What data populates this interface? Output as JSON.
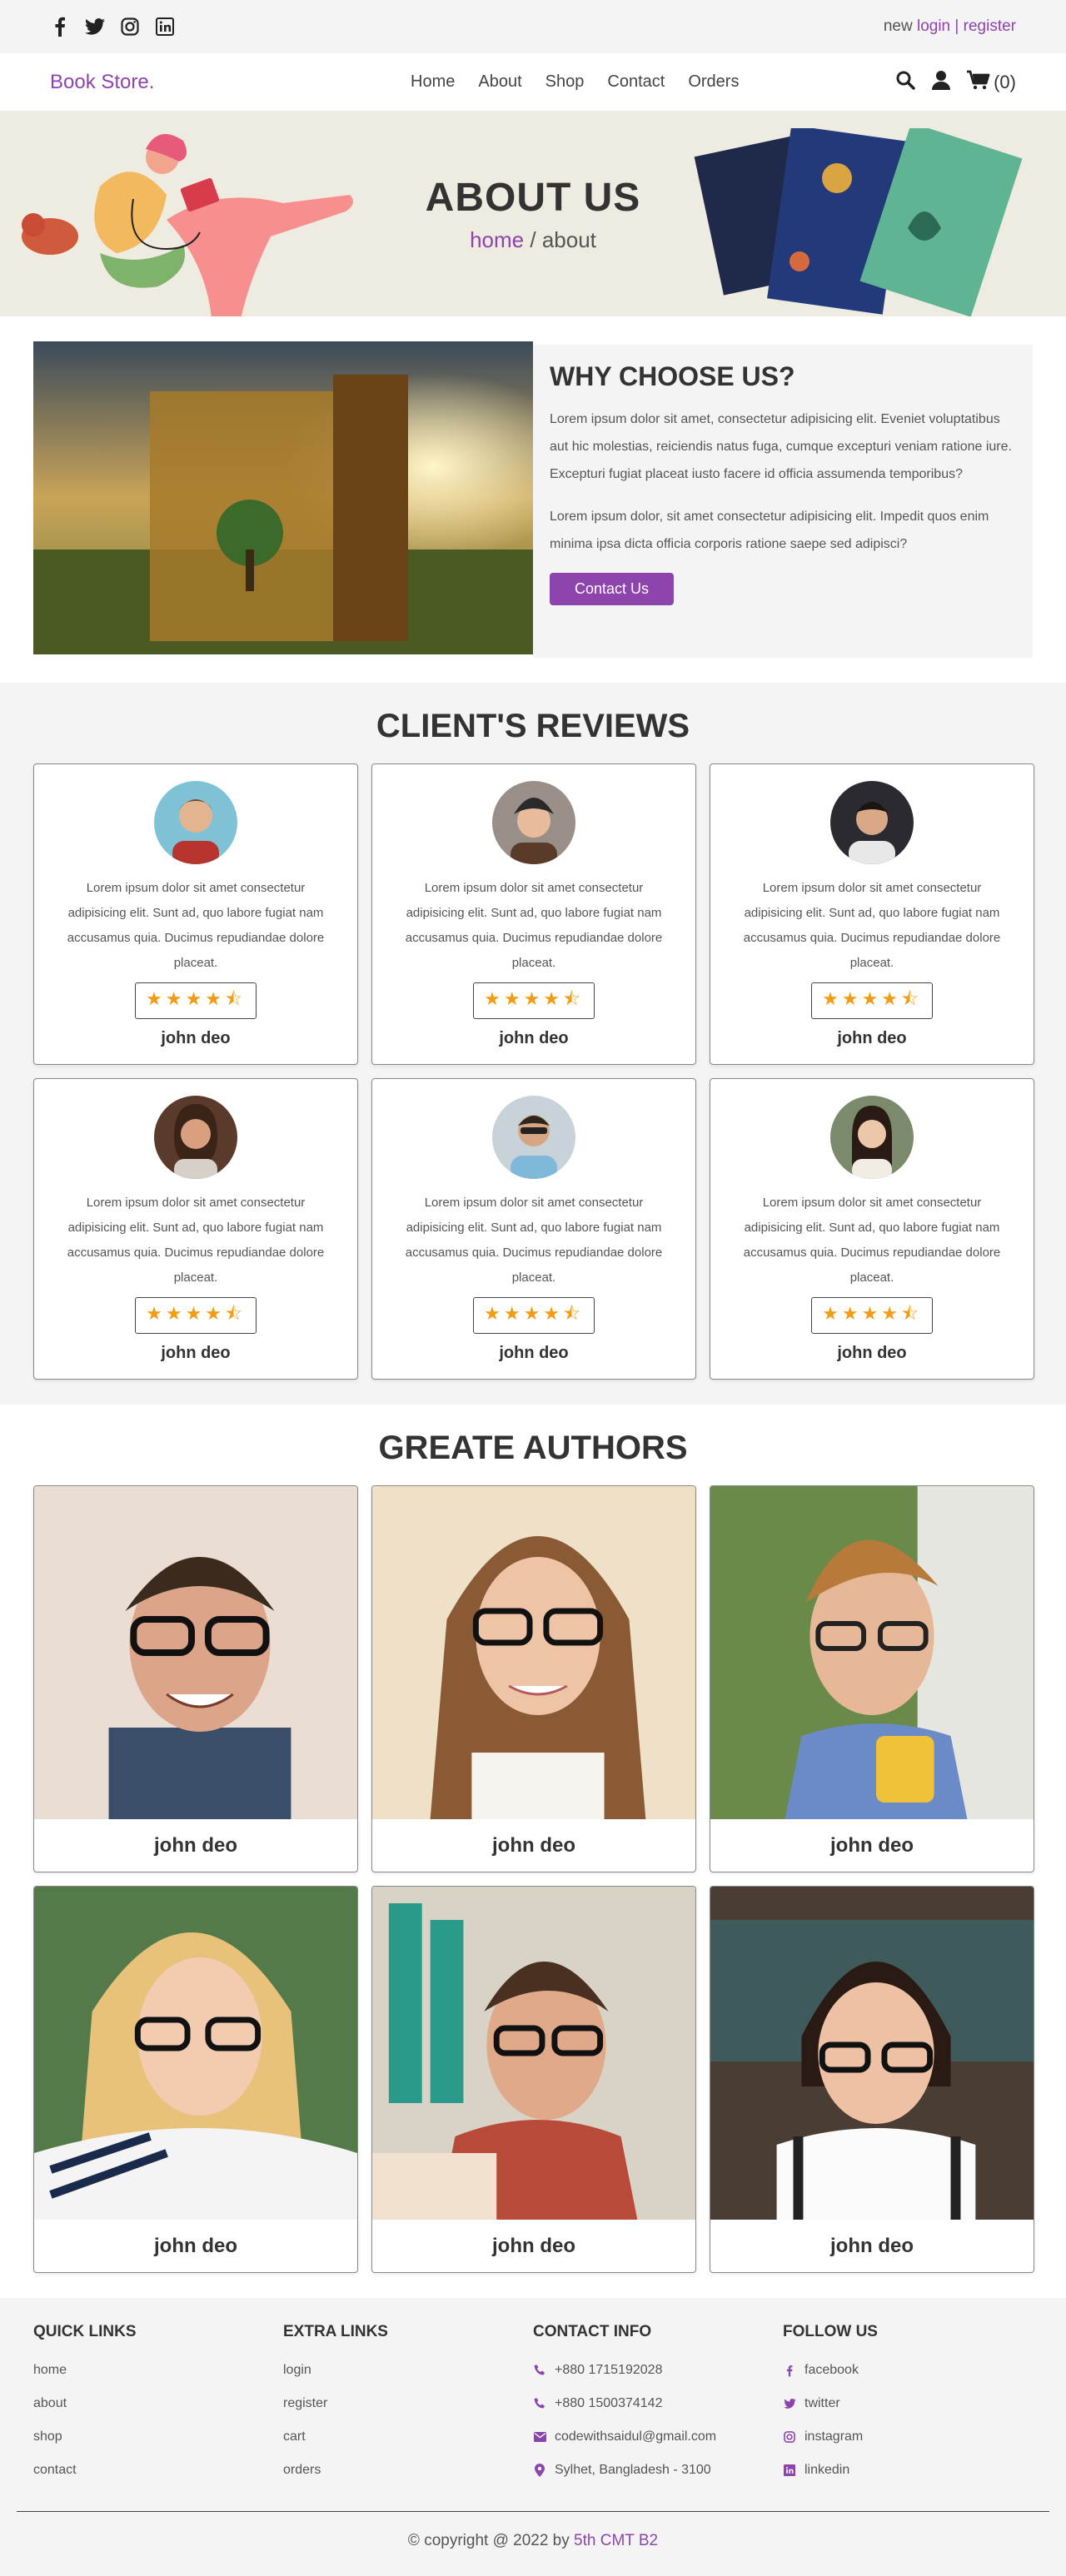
{
  "topbar": {
    "social_icons": [
      "facebook-icon",
      "twitter-icon",
      "instagram-icon",
      "linkedin-icon"
    ],
    "new_label": "new",
    "login_label": "login",
    "separator": "|",
    "register_label": "register"
  },
  "navbar": {
    "logo": "Book Store.",
    "menu": [
      "Home",
      "About",
      "Shop",
      "Contact",
      "Orders"
    ],
    "cart_count": "(0)"
  },
  "hero": {
    "title": "ABOUT US",
    "crumb_home": "home",
    "crumb_sep": "/",
    "crumb_current": "about"
  },
  "why": {
    "title": "WHY CHOOSE US?",
    "paragraph1": "Lorem ipsum dolor sit amet, consectetur adipisicing elit. Eveniet voluptatibus aut hic molestias, reiciendis natus fuga, cumque excepturi veniam ratione iure. Excepturi fugiat placeat iusto facere id officia assumenda temporibus?",
    "paragraph2": "Lorem ipsum dolor, sit amet consectetur adipisicing elit. Impedit quos enim minima ipsa dicta officia corporis ratione saepe sed adipisci?",
    "button": "Contact Us"
  },
  "reviews": {
    "title": "CLIENT'S REVIEWS",
    "items": [
      {
        "text": "Lorem ipsum dolor sit amet consectetur adipisicing elit. Sunt ad, quo labore fugiat nam accusamus quia. Ducimus repudiandae dolore placeat.",
        "name": "john deo",
        "rating": 4.5
      },
      {
        "text": "Lorem ipsum dolor sit amet consectetur adipisicing elit. Sunt ad, quo labore fugiat nam accusamus quia. Ducimus repudiandae dolore placeat.",
        "name": "john deo",
        "rating": 4.5
      },
      {
        "text": "Lorem ipsum dolor sit amet consectetur adipisicing elit. Sunt ad, quo labore fugiat nam accusamus quia. Ducimus repudiandae dolore placeat.",
        "name": "john deo",
        "rating": 4.5
      },
      {
        "text": "Lorem ipsum dolor sit amet consectetur adipisicing elit. Sunt ad, quo labore fugiat nam accusamus quia. Ducimus repudiandae dolore placeat.",
        "name": "john deo",
        "rating": 4.5
      },
      {
        "text": "Lorem ipsum dolor sit amet consectetur adipisicing elit. Sunt ad, quo labore fugiat nam accusamus quia. Ducimus repudiandae dolore placeat.",
        "name": "john deo",
        "rating": 4.5
      },
      {
        "text": "Lorem ipsum dolor sit amet consectetur adipisicing elit. Sunt ad, quo labore fugiat nam accusamus quia. Ducimus repudiandae dolore placeat.",
        "name": "john deo",
        "rating": 4.5
      }
    ],
    "stars_text": "★★★★⯪"
  },
  "authors": {
    "title": "GREATE AUTHORS",
    "items": [
      {
        "name": "john deo"
      },
      {
        "name": "john deo"
      },
      {
        "name": "john deo"
      },
      {
        "name": "john deo"
      },
      {
        "name": "john deo"
      },
      {
        "name": "john deo"
      }
    ]
  },
  "footer": {
    "quick_links": {
      "title": "QUICK LINKS",
      "items": [
        "home",
        "about",
        "shop",
        "contact"
      ]
    },
    "extra_links": {
      "title": "EXTRA LINKS",
      "items": [
        "login",
        "register",
        "cart",
        "orders"
      ]
    },
    "contact_info": {
      "title": "CONTACT INFO",
      "items": [
        "+880 1715192028",
        "+880 1500374142",
        "codewithsaidul@gmail.com",
        "Sylhet, Bangladesh - 3100"
      ]
    },
    "follow_us": {
      "title": "FOLLOW US",
      "items": [
        "facebook",
        "twitter",
        "instagram",
        "linkedin"
      ]
    },
    "copyright_prefix": "© copyright @ 2022 by",
    "copyright_brand": "5th CMT B2"
  },
  "colors": {
    "accent": "#8e44ad",
    "star": "#f39c12",
    "light_bg": "#f4f4f4",
    "hero_bg": "#eeebe0"
  }
}
